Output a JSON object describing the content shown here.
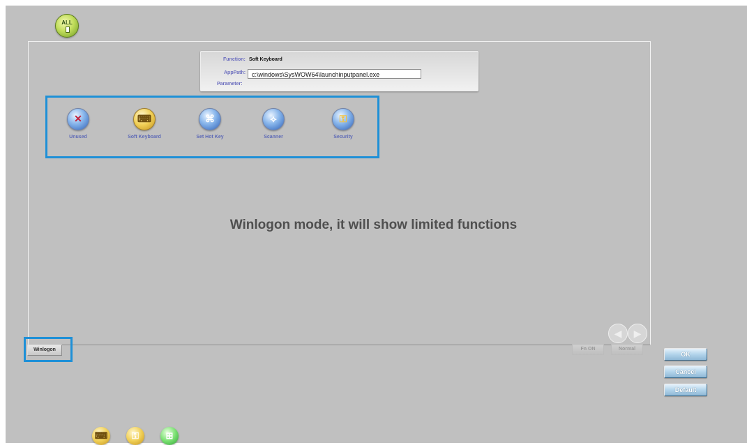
{
  "top": {
    "all_badge": "ALL"
  },
  "info": {
    "function_label": "Function:",
    "function_value": "Soft Keyboard",
    "apppath_label": "AppPath:",
    "apppath_value": "c:\\windows\\SysWOW64\\launchinputpanel.exe",
    "parameter_label": "Parameter:"
  },
  "functions": [
    {
      "label": "Unused",
      "icon": "x-icon",
      "color": "#2f61b8"
    },
    {
      "label": "Soft Keyboard",
      "icon": "keyboard-icon",
      "color": "#e0b33a"
    },
    {
      "label": "Set Hot Key",
      "icon": "hotkey-icon",
      "color": "#2f61b8"
    },
    {
      "label": "Scanner",
      "icon": "scanner-icon",
      "color": "#2f61b8"
    },
    {
      "label": "Security",
      "icon": "key-icon",
      "color": "#2f61b8"
    }
  ],
  "message": "Winlogon mode, it will show limited functions",
  "mode_button": "Winlogon",
  "fn_button": "Fn ON",
  "normal_button": "Normal",
  "actions": {
    "ok": "OK",
    "cancel": "Cancel",
    "default": "Default"
  },
  "accent": "#1e90d7"
}
